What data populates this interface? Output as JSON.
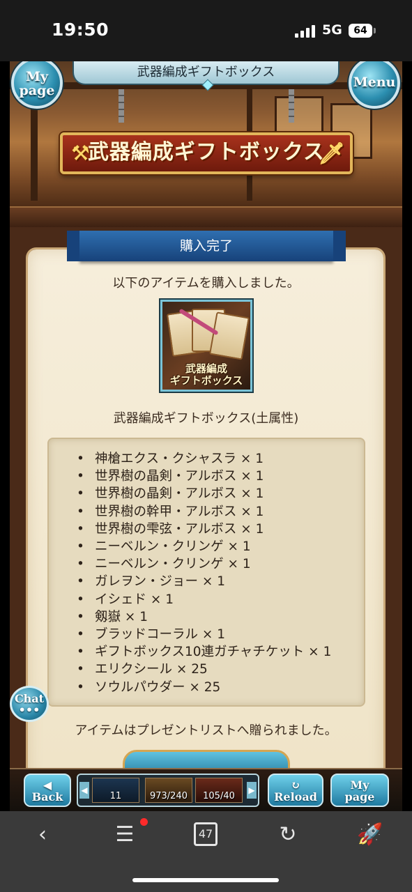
{
  "status": {
    "time": "19:50",
    "network": "5G",
    "battery": "64"
  },
  "game": {
    "header_title": "武器編成ギフトボックス",
    "mypage_button": "My\npage",
    "menu_button": "Menu",
    "banner_title": "武器編成ギフトボックス",
    "ribbon_title": "購入完了",
    "purchase_message": "以下のアイテムを購入しました。",
    "item_image_label": "武器編成\nギフトボックス",
    "item_name": "武器編成ギフトボックス(土属性)",
    "contents": [
      "神槍エクス・クシャスラ × 1",
      "世界樹の晶剣・アルボス × 1",
      "世界樹の晶剣・アルボス × 1",
      "世界樹の幹甲・アルボス × 1",
      "世界樹の雫弦・アルボス × 1",
      "ニーベルン・クリンゲ × 1",
      "ニーベルン・クリンゲ × 1",
      "ガレヲン・ジョー × 1",
      "イシェド × 1",
      "剱嶽 × 1",
      "ブラッドコーラル × 1",
      "ギフトボックス10連ガチャチケット × 1",
      "エリクシール × 25",
      "ソウルパウダー × 25"
    ],
    "footer_message": "アイテムはプレゼントリストへ贈られました。",
    "chat_button": "Chat",
    "nav": {
      "back": "Back",
      "reload": "Reload",
      "mypage": "My\npage",
      "slot1": "11",
      "slot2": "973/240",
      "slot3": "105/40"
    }
  },
  "browser": {
    "tab_count": "47"
  },
  "colors": {
    "ribbon": "#17427a",
    "panel": "#f6eedb",
    "accent": "#2c8fb0"
  }
}
